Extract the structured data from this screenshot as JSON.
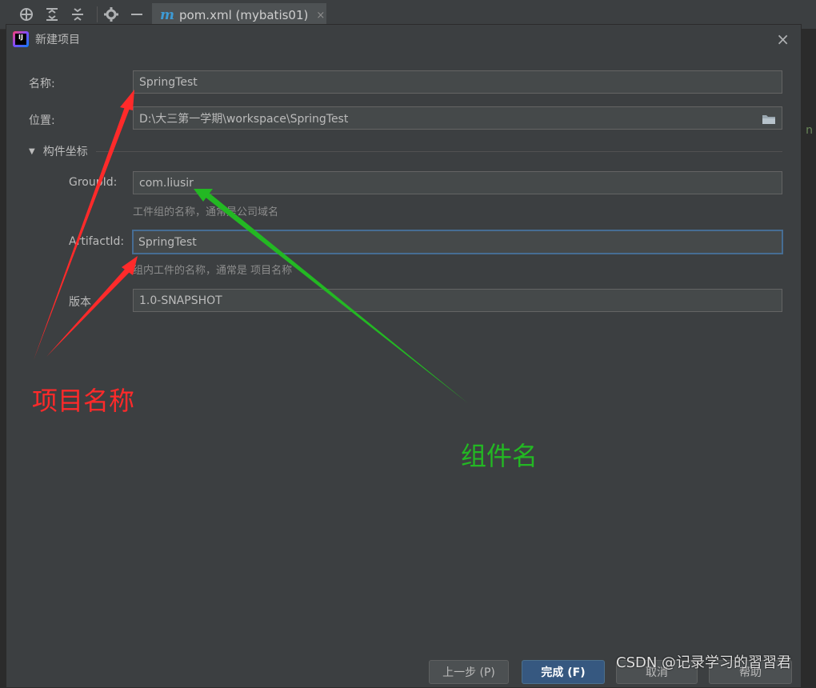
{
  "ide": {
    "toolbar_icons": [
      "crosshair-icon",
      "expand-all-icon",
      "collapse-all-icon",
      "gear-icon",
      "minimize-icon"
    ],
    "editor_tab": {
      "icon": "m",
      "label": "pom.xml (mybatis01)",
      "close": "×"
    },
    "editor_glyph": "n"
  },
  "dialog": {
    "title": "新建项目",
    "close": "×",
    "name_label": "名称:",
    "name_value": "SpringTest",
    "location_label": "位置:",
    "location_value": "D:\\大三第一学期\\workspace\\SpringTest",
    "section_label": "构件坐标",
    "groupid_label": "GroupId:",
    "groupid_value": "com.liusir",
    "groupid_hint": "工件组的名称，通常是公司域名",
    "artifactid_label": "ArtifactId:",
    "artifactid_value": "SpringTest",
    "artifactid_hint": "组内工件的名称，通常是 项目名称",
    "version_label": "版本",
    "version_value": "1.0-SNAPSHOT",
    "buttons": {
      "previous": "上一步 (P)",
      "finish": "完成 (F)",
      "cancel": "取消",
      "help": "帮助"
    }
  },
  "annotations": {
    "red_label": "项目名称",
    "green_label": "组件名",
    "red_color": "#ff2a2a",
    "green_color": "#23b823"
  },
  "watermark": "CSDN @记录学习的習習君"
}
